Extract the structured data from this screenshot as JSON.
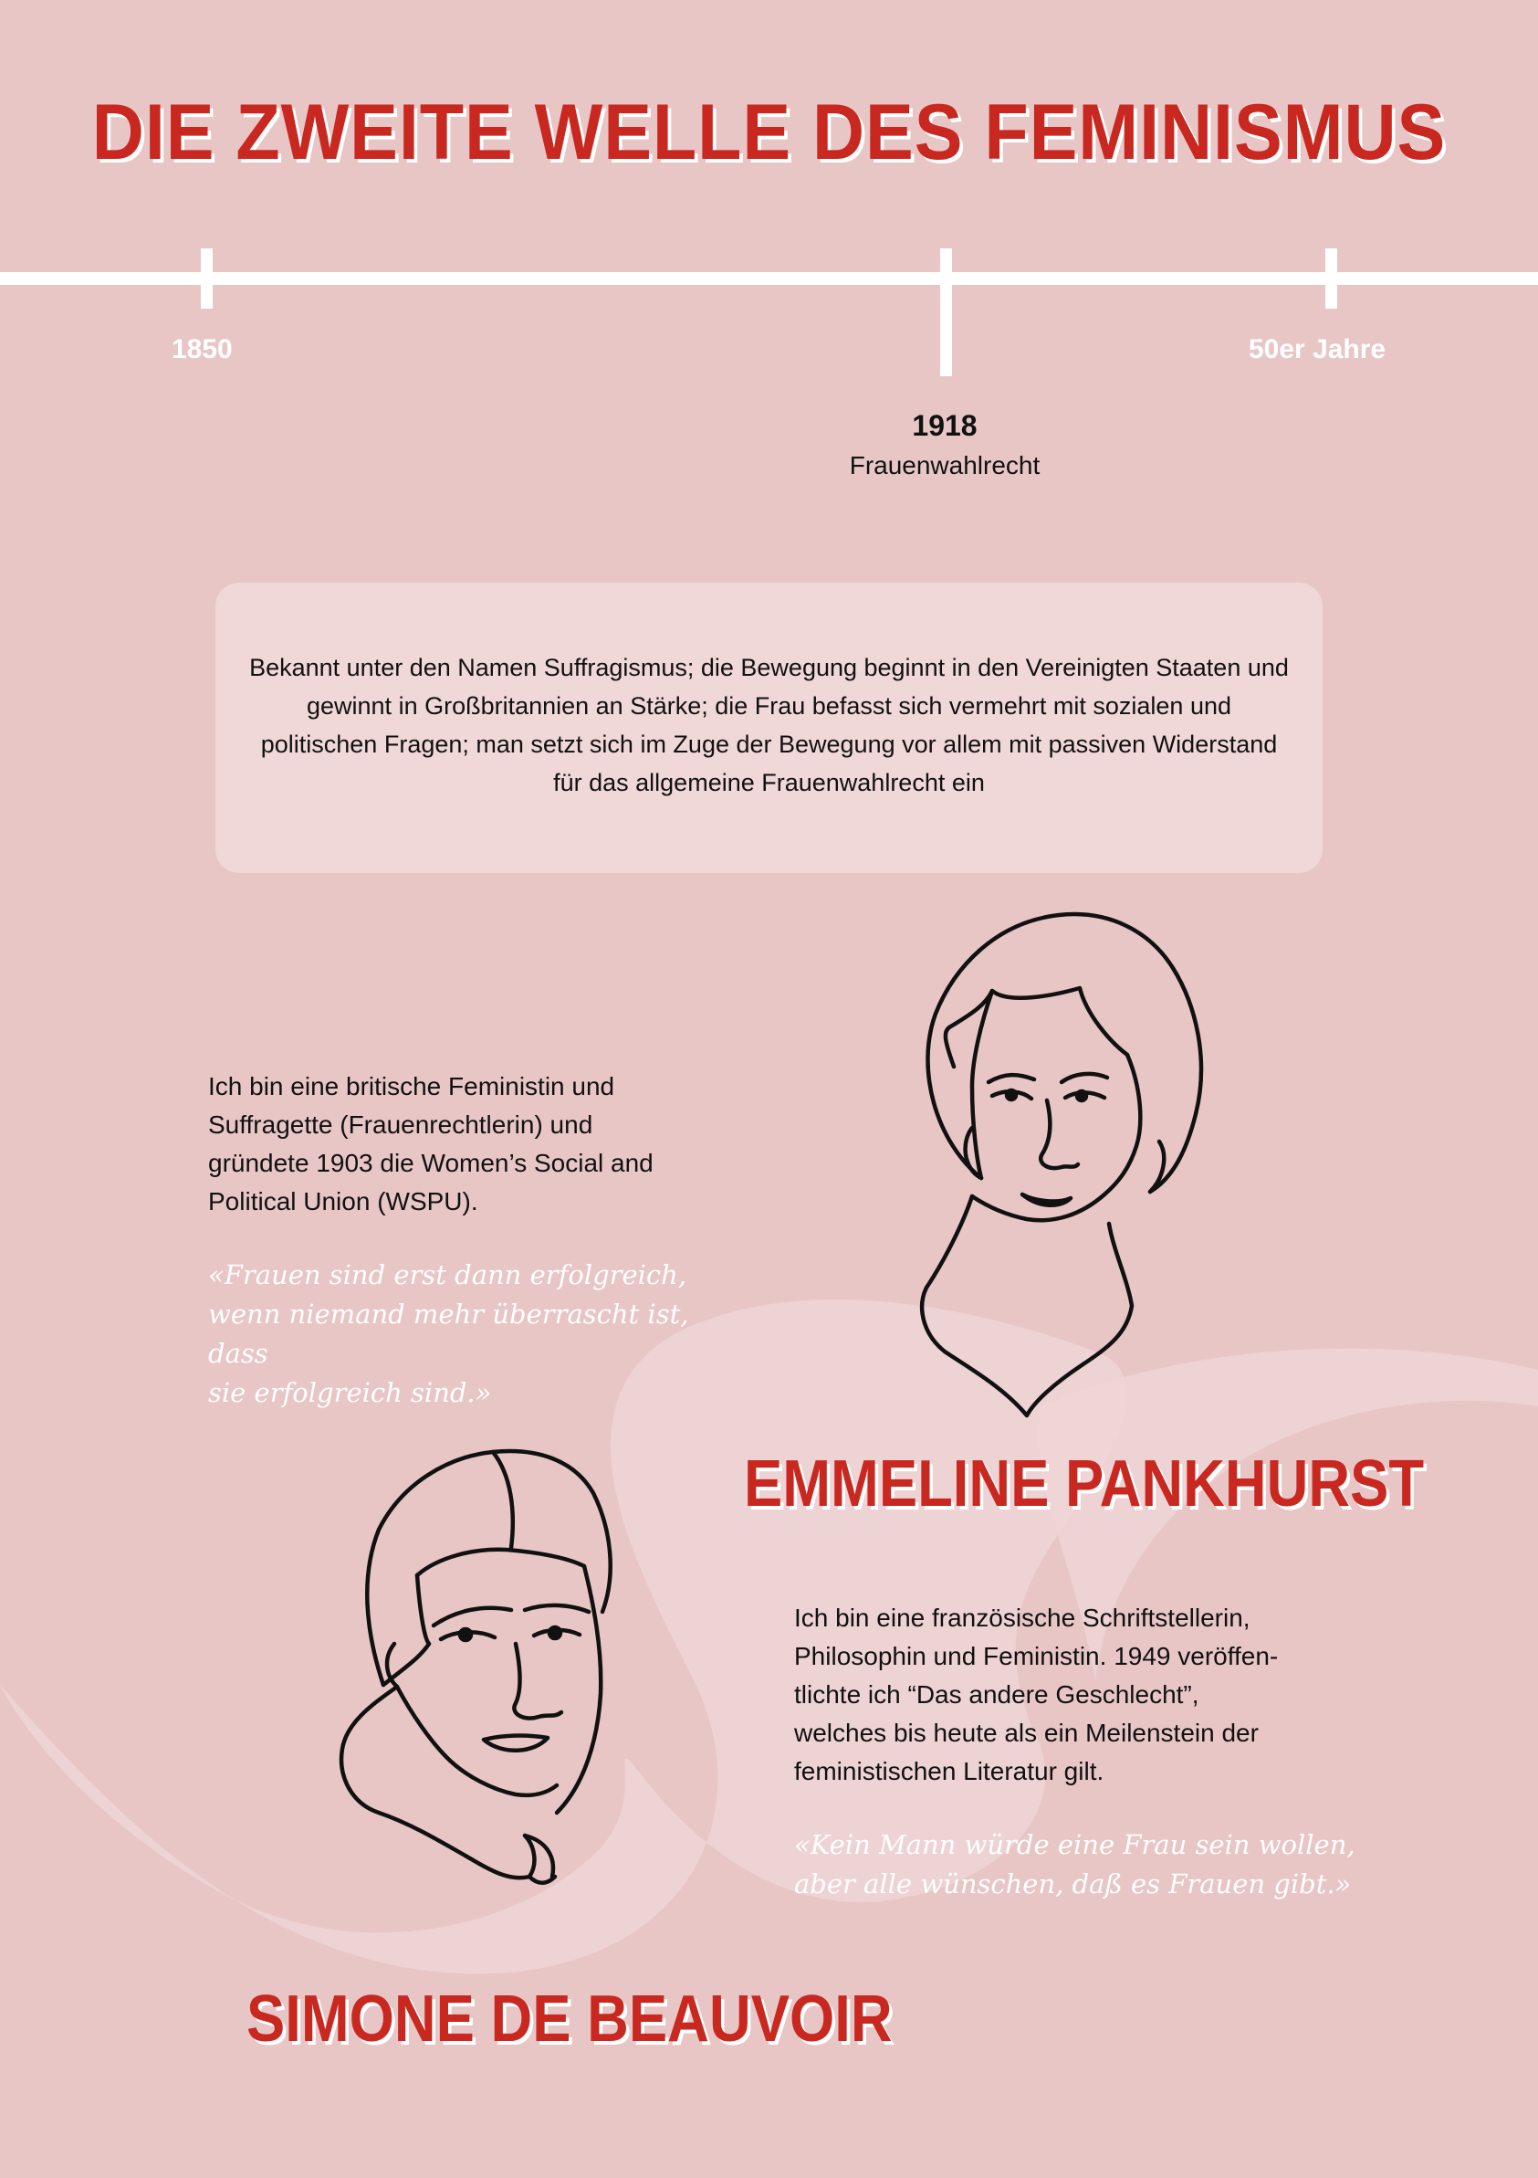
{
  "title": "DIE ZWEITE WELLE DES FEMINISMUS",
  "timeline": {
    "start": "1850",
    "end": "50er Jahre",
    "event": {
      "year": "1918",
      "label": "Frauenwahlrecht"
    }
  },
  "intro": "Bekannt unter den Namen Suffragismus; die Bewegung beginnt in den Vereinigten Staaten und gewinnt in Großbritannien an Stärke; die Frau befasst sich vermehrt mit sozialen und politischen Fragen; man setzt sich im Zuge der Bewegung vor allem mit passiven Widerstand für das allgemeine Frauenwahlrecht ein",
  "pankhurst": {
    "name": "EMMELINE PANKHURST",
    "bio_lines": [
      "Ich bin eine britische Feministin und",
      "Suffragette (Frauenrechtlerin) und",
      "gründete 1903 die Women’s Social and",
      "Political Union (WSPU)."
    ],
    "quote_lines": [
      "«Frauen sind erst dann erfolgreich,",
      "wenn niemand mehr überrascht ist, dass",
      "sie erfolgreich sind.»"
    ]
  },
  "beauvoir": {
    "name": "SIMONE DE BEAUVOIR",
    "bio_lines": [
      "Ich bin eine französische Schriftstellerin,",
      "Philosophin und Feministin. 1949 veröffen-",
      "tlichte ich “Das andere Geschlecht”,",
      "welches bis heute als ein Meilenstein der",
      "feministischen Literatur gilt."
    ],
    "quote_lines": [
      "«Kein Mann würde eine Frau sein wollen,",
      "aber alle wünschen, daß es Frauen gibt.»"
    ]
  },
  "colors": {
    "background": "#e8c6c6",
    "accent": "#c8281f",
    "panel": "#f0d7d8",
    "line": "#ffffff"
  }
}
